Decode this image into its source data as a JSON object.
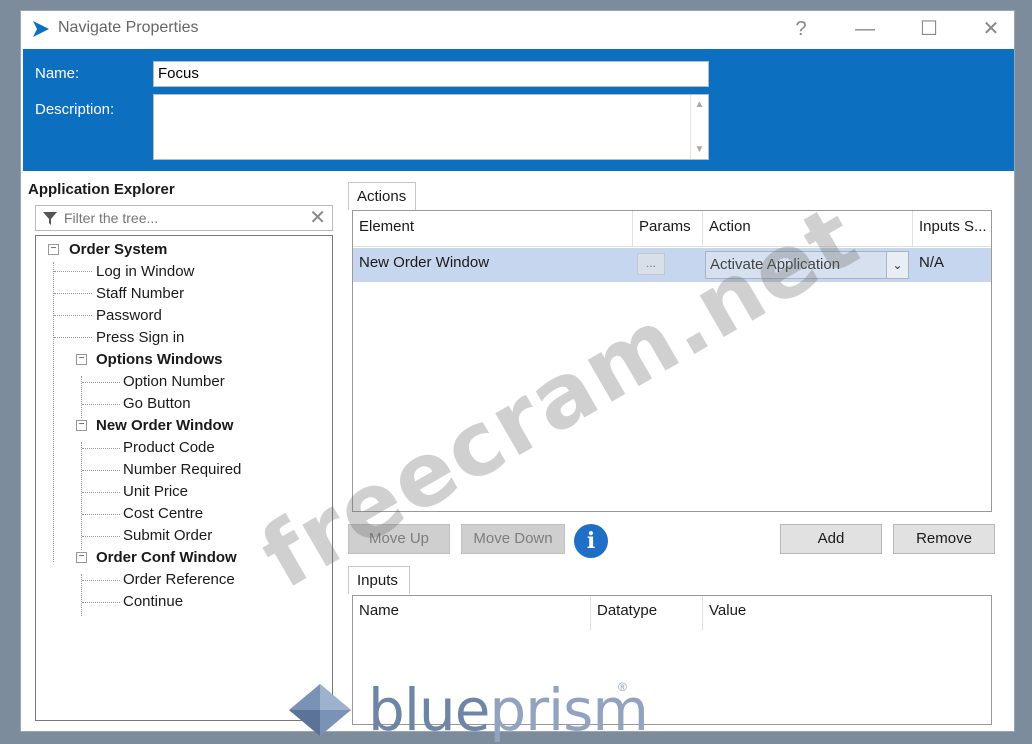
{
  "window": {
    "title": "Navigate Properties",
    "controls": {
      "help": "?",
      "minimize": "—",
      "maximize": "☐",
      "close": "✕"
    }
  },
  "header": {
    "name_label": "Name:",
    "name_value": "Focus",
    "description_label": "Description:",
    "description_value": ""
  },
  "explorer": {
    "label": "Application Explorer",
    "filter_placeholder": "Filter the tree...",
    "tree": {
      "root": "Order System",
      "items": [
        "Log in Window",
        "Staff Number",
        "Password",
        "Press Sign in"
      ],
      "groups": [
        {
          "label": "Options Windows",
          "children": [
            "Option Number",
            "Go Button"
          ]
        },
        {
          "label": "New Order Window",
          "children": [
            "Product Code",
            "Number Required",
            "Unit Price",
            "Cost Centre",
            "Submit Order"
          ]
        },
        {
          "label": "Order Conf Window",
          "children": [
            "Order Reference",
            "Continue"
          ]
        }
      ]
    }
  },
  "actions": {
    "tab_label": "Actions",
    "columns": [
      "Element",
      "Params",
      "Action",
      "Inputs S..."
    ],
    "rows": [
      {
        "element": "New Order Window",
        "params": "...",
        "action": "Activate Application",
        "inputs": "N/A"
      }
    ]
  },
  "buttons": {
    "move_up": "Move Up",
    "move_down": "Move Down",
    "add": "Add",
    "remove": "Remove"
  },
  "inputs": {
    "tab_label": "Inputs",
    "columns": [
      "Name",
      "Datatype",
      "Value"
    ]
  },
  "watermark": "freecram.net",
  "branding": {
    "logo_text_bold": "blue",
    "logo_text_light": "prism",
    "registered": "®"
  },
  "colors": {
    "header_blue": "#0c6fc0",
    "selected_row": "#c5d6ee",
    "info_blue": "#1f6fc7"
  }
}
